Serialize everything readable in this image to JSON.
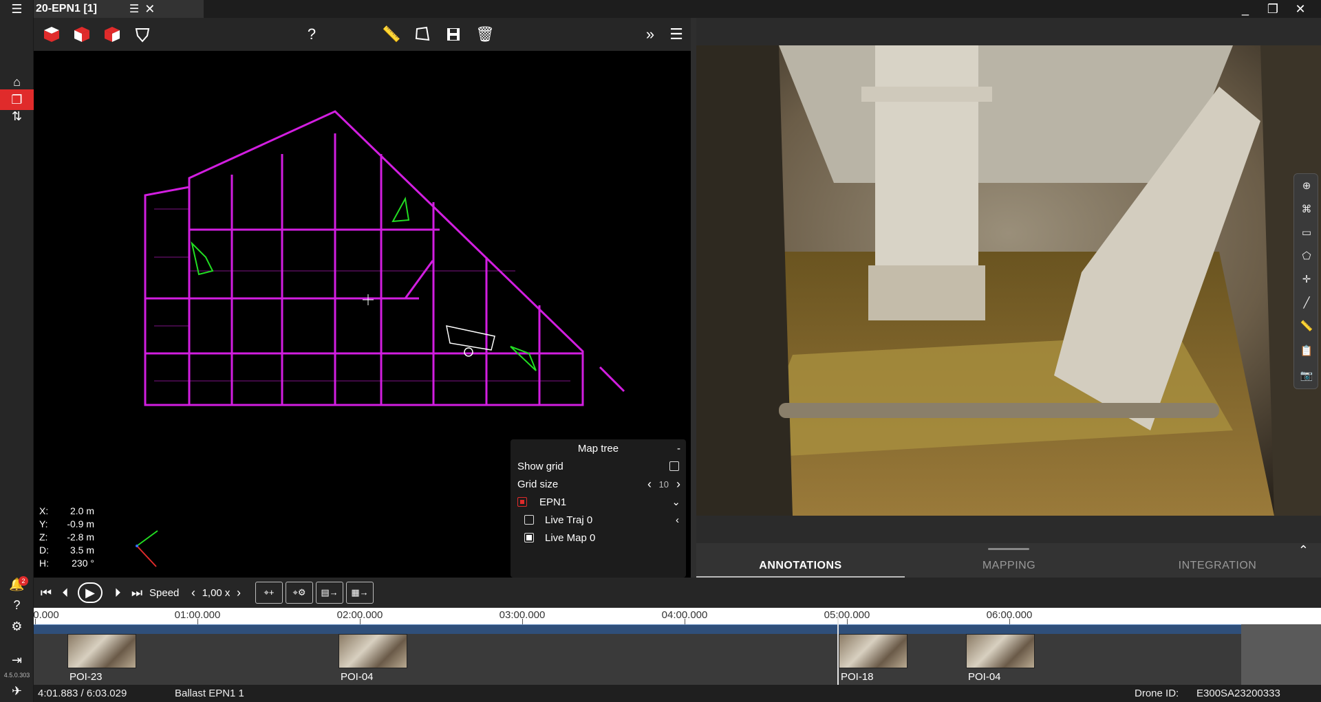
{
  "window": {
    "title": "20-EPN1 [1]"
  },
  "sidebar": {
    "version": "4.5.0.303",
    "notifications": "2"
  },
  "toolbar3d": {
    "help": "?"
  },
  "coords": [
    {
      "k": "X:",
      "v": "2.0 m"
    },
    {
      "k": "Y:",
      "v": "-0.9 m"
    },
    {
      "k": "Z:",
      "v": "-2.8 m"
    },
    {
      "k": "D:",
      "v": "3.5 m"
    },
    {
      "k": "H:",
      "v": "230 °"
    }
  ],
  "maptree": {
    "title": "Map tree",
    "collapse": "-",
    "show_grid": "Show grid",
    "grid_size_label": "Grid size",
    "grid_size": "10",
    "layer": "EPN1",
    "live_traj": "Live Traj 0",
    "live_map": "Live Map 0"
  },
  "tabs": [
    "ANNOTATIONS",
    "MAPPING",
    "INTEGRATION"
  ],
  "player": {
    "speed_label": "Speed",
    "speed": "1,00 x"
  },
  "timeline": {
    "ticks": [
      "0.000",
      "01:00.000",
      "02:00.000",
      "03:00.000",
      "04:00.000",
      "05:00.000",
      "06:00.000"
    ],
    "pois": [
      "POI-23",
      "POI-04",
      "POI-18",
      "POI-04"
    ]
  },
  "status": {
    "time": "4:01.883 / 6:03.029",
    "path": "Ballast EPN1 1",
    "drone_label": "Drone ID:",
    "drone_id": "E300SA23200333"
  },
  "colors": {
    "accent": "#e02b2b",
    "pointcloud": "#d21ee0",
    "trajectory": "#22dd22"
  }
}
